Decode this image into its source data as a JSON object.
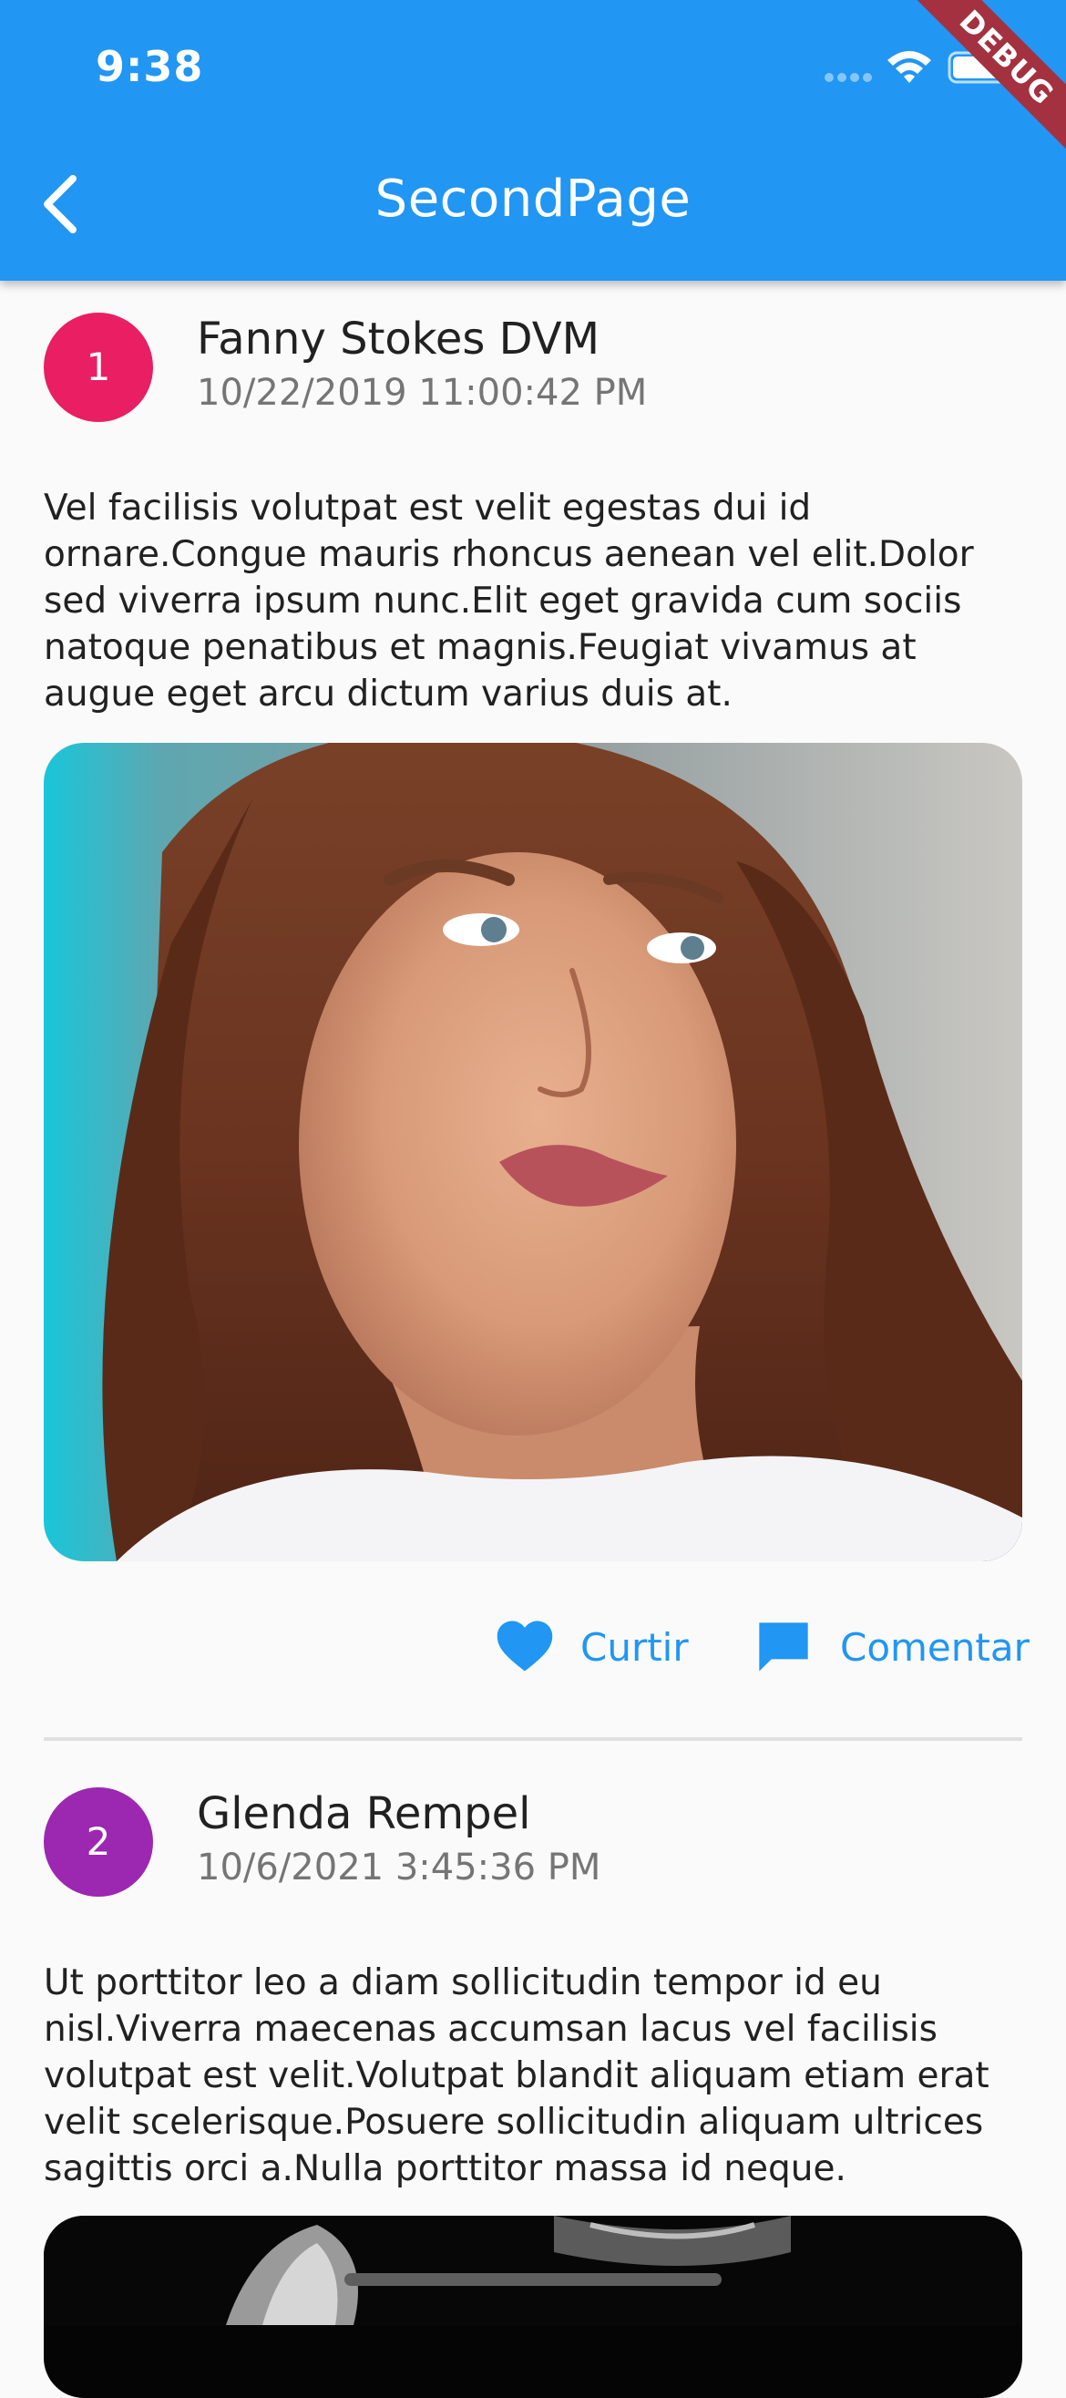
{
  "status_bar": {
    "time": "9:38"
  },
  "app_bar": {
    "title": "SecondPage",
    "debug_banner": "DEBUG"
  },
  "colors": {
    "app_bar": "#2196F3",
    "accent": "#2196F3",
    "avatar_1": "#E91E63",
    "avatar_2": "#9C27B0"
  },
  "actions": {
    "like_label": "Curtir",
    "comment_label": "Comentar"
  },
  "posts": [
    {
      "number": "1",
      "author": "Fanny Stokes DVM",
      "date": "10/22/2019 11:00:42 PM",
      "body": "Vel facilisis volutpat est velit egestas dui id ornare.Congue mauris rhoncus aenean vel elit.Dolor sed viverra ipsum nunc.Elit eget gravida cum sociis natoque penatibus et magnis.Feugiat vivamus at augue eget arcu dictum varius duis at."
    },
    {
      "number": "2",
      "author": "Glenda Rempel",
      "date": "10/6/2021 3:45:36 PM",
      "body": "Ut porttitor leo a diam sollicitudin tempor id eu nisl.Viverra maecenas accumsan lacus vel facilisis volutpat est velit.Volutpat blandit aliquam etiam erat velit scelerisque.Posuere sollicitudin aliquam ultrices sagittis orci a.Nulla porttitor massa id neque."
    }
  ]
}
